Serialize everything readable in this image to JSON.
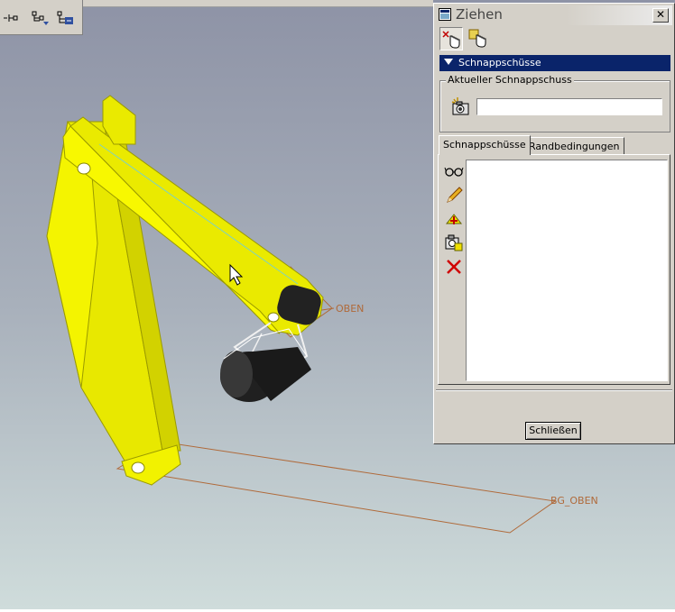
{
  "dialog": {
    "title": "Ziehen",
    "section_title": "Schnappschüsse",
    "group_label": "Aktueller Schnappschuss",
    "snapshot_value": "",
    "tabs": [
      {
        "label": "Schnappschüsse",
        "active": true
      },
      {
        "label": "Randbedingungen",
        "active": false
      }
    ],
    "close_button": "Schließen"
  },
  "viewport": {
    "datum_labels": [
      "OBEN",
      "BG_OBEN"
    ]
  },
  "icons": {
    "toolbar": [
      "tree-expand-icon",
      "tree-filter-icon",
      "tree-settings-icon"
    ],
    "dialog_tools": [
      "drag-point-icon",
      "drag-body-icon"
    ],
    "side_tools": [
      "view-snapshot-icon",
      "edit-snapshot-icon",
      "add-snapshot-icon",
      "camera-snapshot-icon",
      "delete-snapshot-icon"
    ]
  },
  "colors": {
    "model_yellow": "#ecec00",
    "datum_orange": "#b06a3a",
    "selection_blue": "#0a246a"
  }
}
